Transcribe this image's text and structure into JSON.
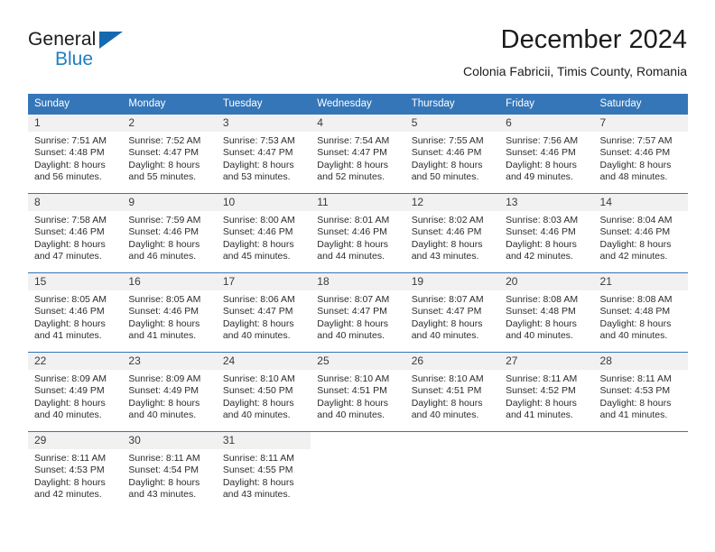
{
  "brand": {
    "line1": "General",
    "line2": "Blue",
    "triangle_color": "#1569b0",
    "blue_color": "#1f7ec4"
  },
  "header": {
    "title": "December 2024",
    "subtitle": "Colonia Fabricii, Timis County, Romania"
  },
  "theme": {
    "header_blue": "#3576b8",
    "daynum_band": "#f1f1f1",
    "text": "#2c2c2c"
  },
  "weekdays": [
    "Sunday",
    "Monday",
    "Tuesday",
    "Wednesday",
    "Thursday",
    "Friday",
    "Saturday"
  ],
  "weeks": [
    [
      {
        "day": "1",
        "sunrise": "Sunrise: 7:51 AM",
        "sunset": "Sunset: 4:48 PM",
        "daylight_a": "Daylight: 8 hours",
        "daylight_b": "and 56 minutes."
      },
      {
        "day": "2",
        "sunrise": "Sunrise: 7:52 AM",
        "sunset": "Sunset: 4:47 PM",
        "daylight_a": "Daylight: 8 hours",
        "daylight_b": "and 55 minutes."
      },
      {
        "day": "3",
        "sunrise": "Sunrise: 7:53 AM",
        "sunset": "Sunset: 4:47 PM",
        "daylight_a": "Daylight: 8 hours",
        "daylight_b": "and 53 minutes."
      },
      {
        "day": "4",
        "sunrise": "Sunrise: 7:54 AM",
        "sunset": "Sunset: 4:47 PM",
        "daylight_a": "Daylight: 8 hours",
        "daylight_b": "and 52 minutes."
      },
      {
        "day": "5",
        "sunrise": "Sunrise: 7:55 AM",
        "sunset": "Sunset: 4:46 PM",
        "daylight_a": "Daylight: 8 hours",
        "daylight_b": "and 50 minutes."
      },
      {
        "day": "6",
        "sunrise": "Sunrise: 7:56 AM",
        "sunset": "Sunset: 4:46 PM",
        "daylight_a": "Daylight: 8 hours",
        "daylight_b": "and 49 minutes."
      },
      {
        "day": "7",
        "sunrise": "Sunrise: 7:57 AM",
        "sunset": "Sunset: 4:46 PM",
        "daylight_a": "Daylight: 8 hours",
        "daylight_b": "and 48 minutes."
      }
    ],
    [
      {
        "day": "8",
        "sunrise": "Sunrise: 7:58 AM",
        "sunset": "Sunset: 4:46 PM",
        "daylight_a": "Daylight: 8 hours",
        "daylight_b": "and 47 minutes."
      },
      {
        "day": "9",
        "sunrise": "Sunrise: 7:59 AM",
        "sunset": "Sunset: 4:46 PM",
        "daylight_a": "Daylight: 8 hours",
        "daylight_b": "and 46 minutes."
      },
      {
        "day": "10",
        "sunrise": "Sunrise: 8:00 AM",
        "sunset": "Sunset: 4:46 PM",
        "daylight_a": "Daylight: 8 hours",
        "daylight_b": "and 45 minutes."
      },
      {
        "day": "11",
        "sunrise": "Sunrise: 8:01 AM",
        "sunset": "Sunset: 4:46 PM",
        "daylight_a": "Daylight: 8 hours",
        "daylight_b": "and 44 minutes."
      },
      {
        "day": "12",
        "sunrise": "Sunrise: 8:02 AM",
        "sunset": "Sunset: 4:46 PM",
        "daylight_a": "Daylight: 8 hours",
        "daylight_b": "and 43 minutes."
      },
      {
        "day": "13",
        "sunrise": "Sunrise: 8:03 AM",
        "sunset": "Sunset: 4:46 PM",
        "daylight_a": "Daylight: 8 hours",
        "daylight_b": "and 42 minutes."
      },
      {
        "day": "14",
        "sunrise": "Sunrise: 8:04 AM",
        "sunset": "Sunset: 4:46 PM",
        "daylight_a": "Daylight: 8 hours",
        "daylight_b": "and 42 minutes."
      }
    ],
    [
      {
        "day": "15",
        "sunrise": "Sunrise: 8:05 AM",
        "sunset": "Sunset: 4:46 PM",
        "daylight_a": "Daylight: 8 hours",
        "daylight_b": "and 41 minutes."
      },
      {
        "day": "16",
        "sunrise": "Sunrise: 8:05 AM",
        "sunset": "Sunset: 4:46 PM",
        "daylight_a": "Daylight: 8 hours",
        "daylight_b": "and 41 minutes."
      },
      {
        "day": "17",
        "sunrise": "Sunrise: 8:06 AM",
        "sunset": "Sunset: 4:47 PM",
        "daylight_a": "Daylight: 8 hours",
        "daylight_b": "and 40 minutes."
      },
      {
        "day": "18",
        "sunrise": "Sunrise: 8:07 AM",
        "sunset": "Sunset: 4:47 PM",
        "daylight_a": "Daylight: 8 hours",
        "daylight_b": "and 40 minutes."
      },
      {
        "day": "19",
        "sunrise": "Sunrise: 8:07 AM",
        "sunset": "Sunset: 4:47 PM",
        "daylight_a": "Daylight: 8 hours",
        "daylight_b": "and 40 minutes."
      },
      {
        "day": "20",
        "sunrise": "Sunrise: 8:08 AM",
        "sunset": "Sunset: 4:48 PM",
        "daylight_a": "Daylight: 8 hours",
        "daylight_b": "and 40 minutes."
      },
      {
        "day": "21",
        "sunrise": "Sunrise: 8:08 AM",
        "sunset": "Sunset: 4:48 PM",
        "daylight_a": "Daylight: 8 hours",
        "daylight_b": "and 40 minutes."
      }
    ],
    [
      {
        "day": "22",
        "sunrise": "Sunrise: 8:09 AM",
        "sunset": "Sunset: 4:49 PM",
        "daylight_a": "Daylight: 8 hours",
        "daylight_b": "and 40 minutes."
      },
      {
        "day": "23",
        "sunrise": "Sunrise: 8:09 AM",
        "sunset": "Sunset: 4:49 PM",
        "daylight_a": "Daylight: 8 hours",
        "daylight_b": "and 40 minutes."
      },
      {
        "day": "24",
        "sunrise": "Sunrise: 8:10 AM",
        "sunset": "Sunset: 4:50 PM",
        "daylight_a": "Daylight: 8 hours",
        "daylight_b": "and 40 minutes."
      },
      {
        "day": "25",
        "sunrise": "Sunrise: 8:10 AM",
        "sunset": "Sunset: 4:51 PM",
        "daylight_a": "Daylight: 8 hours",
        "daylight_b": "and 40 minutes."
      },
      {
        "day": "26",
        "sunrise": "Sunrise: 8:10 AM",
        "sunset": "Sunset: 4:51 PM",
        "daylight_a": "Daylight: 8 hours",
        "daylight_b": "and 40 minutes."
      },
      {
        "day": "27",
        "sunrise": "Sunrise: 8:11 AM",
        "sunset": "Sunset: 4:52 PM",
        "daylight_a": "Daylight: 8 hours",
        "daylight_b": "and 41 minutes."
      },
      {
        "day": "28",
        "sunrise": "Sunrise: 8:11 AM",
        "sunset": "Sunset: 4:53 PM",
        "daylight_a": "Daylight: 8 hours",
        "daylight_b": "and 41 minutes."
      }
    ],
    [
      {
        "day": "29",
        "sunrise": "Sunrise: 8:11 AM",
        "sunset": "Sunset: 4:53 PM",
        "daylight_a": "Daylight: 8 hours",
        "daylight_b": "and 42 minutes."
      },
      {
        "day": "30",
        "sunrise": "Sunrise: 8:11 AM",
        "sunset": "Sunset: 4:54 PM",
        "daylight_a": "Daylight: 8 hours",
        "daylight_b": "and 43 minutes."
      },
      {
        "day": "31",
        "sunrise": "Sunrise: 8:11 AM",
        "sunset": "Sunset: 4:55 PM",
        "daylight_a": "Daylight: 8 hours",
        "daylight_b": "and 43 minutes."
      },
      {
        "day": "",
        "sunrise": "",
        "sunset": "",
        "daylight_a": "",
        "daylight_b": ""
      },
      {
        "day": "",
        "sunrise": "",
        "sunset": "",
        "daylight_a": "",
        "daylight_b": ""
      },
      {
        "day": "",
        "sunrise": "",
        "sunset": "",
        "daylight_a": "",
        "daylight_b": ""
      },
      {
        "day": "",
        "sunrise": "",
        "sunset": "",
        "daylight_a": "",
        "daylight_b": ""
      }
    ]
  ]
}
